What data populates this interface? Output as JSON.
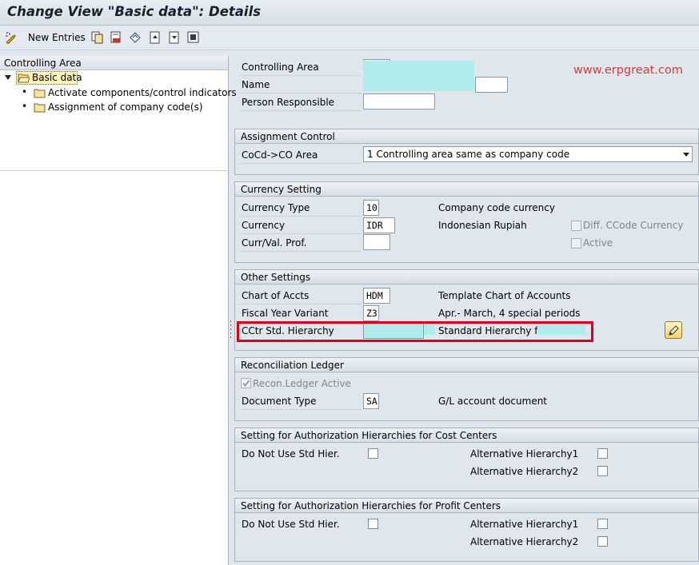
{
  "window": {
    "title": "Change View \"Basic data\": Details"
  },
  "toolbar": {
    "new_entries_label": "New Entries",
    "icons": [
      "new-entries-icon",
      "copy-icon",
      "delete-icon",
      "undo-icon",
      "previous-entry-icon",
      "next-entry-icon",
      "select-all-icon"
    ]
  },
  "nav": {
    "header": "Controlling Area",
    "items": [
      {
        "label": "Basic data",
        "selected": true
      },
      {
        "label": "Activate components/control indicators"
      },
      {
        "label": "Assignment of company code(s)"
      }
    ]
  },
  "top": {
    "controlling_area_label": "Controlling Area",
    "name_label": "Name",
    "person_responsible_label": "Person Responsible"
  },
  "watermark": "www.erpgreat.com",
  "assignment": {
    "header": "Assignment Control",
    "cocd_label": "CoCd->CO Area",
    "cocd_value": "1 Controlling area same as company code"
  },
  "currency": {
    "header": "Currency Setting",
    "type_label": "Currency Type",
    "type_value": "10",
    "type_desc": "Company code currency",
    "currency_label": "Currency",
    "currency_value": "IDR",
    "currency_desc": "Indonesian Rupiah",
    "valprof_label": "Curr/Val. Prof.",
    "diff_ccode_label": "Diff. CCode Currency",
    "active_label": "Active"
  },
  "other": {
    "header": "Other Settings",
    "coa_label": "Chart of Accts",
    "coa_value": "HDM",
    "coa_desc": "Template Chart of Accounts",
    "fyv_label": "Fiscal Year Variant",
    "fyv_value": "Z3",
    "fyv_desc": "Apr.- March, 4 special periods",
    "hier_label": "CCtr Std. Hierarchy",
    "hier_desc": "Standard Hierarchy for"
  },
  "recon": {
    "header": "Reconciliation Ledger",
    "active_label": "Recon.Ledger Active",
    "active_checked": true,
    "doctype_label": "Document Type",
    "doctype_value": "SA",
    "doctype_desc": "G/L account document"
  },
  "auth_cc": {
    "header": "Setting for Authorization Hierarchies for Cost Centers",
    "no_std_label": "Do Not Use Std Hier.",
    "alt1_label": "Alternative Hierarchy1",
    "alt2_label": "Alternative Hierarchy2"
  },
  "auth_pc": {
    "header": "Setting for Authorization Hierarchies for Profit Centers",
    "no_std_label": "Do Not Use Std Hier.",
    "alt1_label": "Alternative Hierarchy1",
    "alt2_label": "Alternative Hierarchy2"
  }
}
